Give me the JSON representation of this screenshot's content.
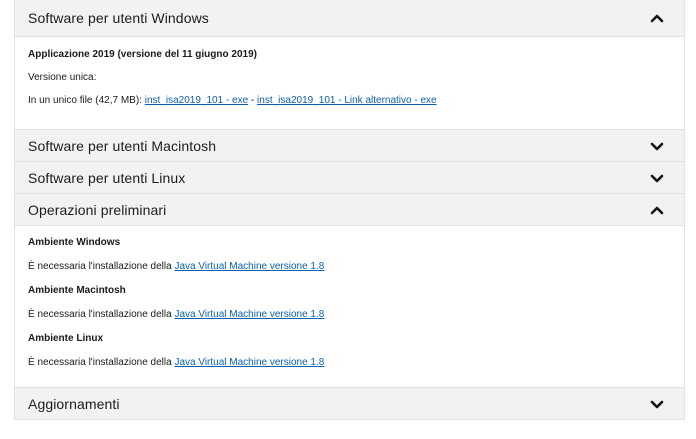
{
  "sections": {
    "windows": {
      "title": "Software per utenti Windows",
      "app_heading": "Applicazione 2019 (versione del 11 giugno 2019)",
      "version_label": "Versione unica:",
      "file_prefix": "In un unico file (42,7 MB):",
      "link_main": "inst_isa2019_101 - exe",
      "separator": " - ",
      "link_alt": "inst_isa2019_101 - Link alternativo - exe"
    },
    "macintosh": {
      "title": "Software per utenti Macintosh"
    },
    "linux": {
      "title": "Software per utenti Linux"
    },
    "preliminari": {
      "title": "Operazioni preliminari",
      "env_windows": "Ambiente Windows",
      "env_macintosh": "Ambiente Macintosh",
      "env_linux": "Ambiente Linux",
      "req_prefix": "È necessaria l'installazione della ",
      "jvm_link": "Java Virtual Machine versione 1.8"
    },
    "aggiornamenti": {
      "title": "Aggiornamenti"
    }
  },
  "icons": {
    "expanded": "chevron-up-icon",
    "collapsed": "chevron-down-icon"
  },
  "colors": {
    "header_bg": "#f2f2f2",
    "link": "#0b5fb0",
    "text": "#1a1a1a"
  }
}
